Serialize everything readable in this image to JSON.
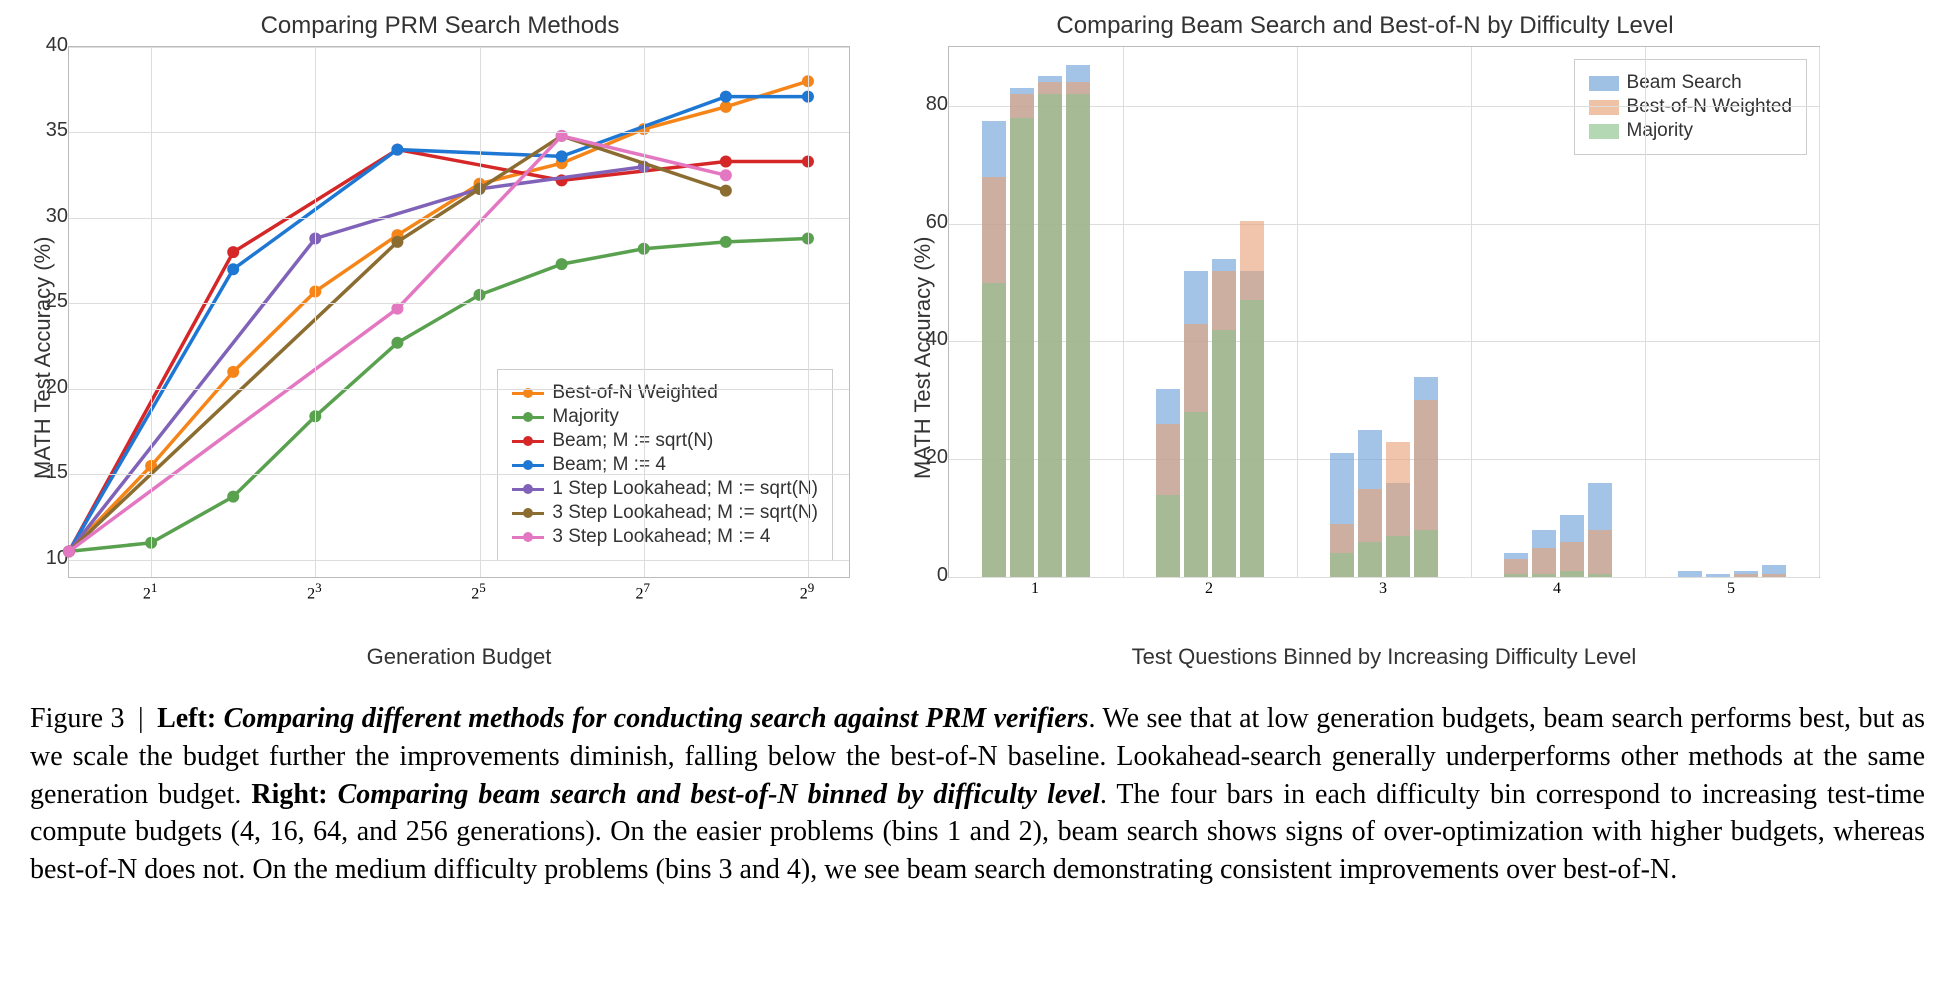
{
  "chart_data": [
    {
      "type": "line",
      "title": "Comparing PRM Search Methods",
      "xlabel": "Generation Budget",
      "ylabel": "MATH Test Accuracy (%)",
      "x_log2": [
        0,
        1,
        2,
        3,
        4,
        5,
        6,
        7,
        8,
        9
      ],
      "x_tick_labels": [
        "2^1",
        "2^3",
        "2^5",
        "2^7",
        "2^9"
      ],
      "x_tick_at_log2": [
        1,
        3,
        5,
        7,
        9
      ],
      "ylim": [
        9,
        40
      ],
      "yticks": [
        10,
        15,
        20,
        25,
        30,
        35,
        40
      ],
      "x_range_log2": [
        0,
        9.5
      ],
      "series": [
        {
          "name": "Best-of-N Weighted",
          "color": "#f58518",
          "x": [
            0,
            1,
            2,
            3,
            4,
            5,
            6,
            7,
            8,
            9
          ],
          "y": [
            10.5,
            15.5,
            21.0,
            25.7,
            29.0,
            32.0,
            33.2,
            35.2,
            36.5,
            38.0
          ]
        },
        {
          "name": "Majority",
          "color": "#59a14f",
          "x": [
            0,
            1,
            2,
            3,
            4,
            5,
            6,
            7,
            8,
            9
          ],
          "y": [
            10.5,
            11.0,
            13.7,
            18.4,
            22.7,
            25.5,
            27.3,
            28.2,
            28.6,
            28.8
          ]
        },
        {
          "name": "Beam; M := sqrt(N)",
          "color": "#d62728",
          "x": [
            0,
            2,
            4,
            6,
            8,
            9
          ],
          "y": [
            10.5,
            28.0,
            34.0,
            32.2,
            33.3,
            33.3
          ]
        },
        {
          "name": "Beam; M := 4",
          "color": "#1f77d4",
          "x": [
            0,
            2,
            4,
            6,
            8,
            9
          ],
          "y": [
            10.5,
            27.0,
            34.0,
            33.6,
            37.1,
            37.1
          ]
        },
        {
          "name": "1 Step Lookahead; M := sqrt(N)",
          "color": "#8063b8",
          "x": [
            0,
            3,
            5,
            7
          ],
          "y": [
            10.5,
            28.8,
            31.7,
            33.0
          ]
        },
        {
          "name": "3 Step Lookahead; M := sqrt(N)",
          "color": "#8c6d31",
          "x": [
            0,
            4,
            5,
            6,
            8
          ],
          "y": [
            10.5,
            28.6,
            31.7,
            34.8,
            31.6
          ]
        },
        {
          "name": "3 Step Lookahead; M := 4",
          "color": "#e377c2",
          "x": [
            0,
            4,
            6,
            8
          ],
          "y": [
            10.5,
            24.7,
            34.8,
            32.5
          ]
        }
      ]
    },
    {
      "type": "bar",
      "title": "Comparing Beam Search and Best-of-N by Difficulty Level",
      "xlabel": "Test Questions Binned by Increasing Difficulty Level",
      "ylabel": "MATH Test Accuracy (%)",
      "ylim": [
        0,
        90
      ],
      "yticks": [
        0,
        20,
        40,
        60,
        80
      ],
      "categories": [
        "1",
        "2",
        "3",
        "4",
        "5"
      ],
      "budgets": [
        4,
        16,
        64,
        256
      ],
      "layers": [
        {
          "name": "Beam Search",
          "color": "#6b9fd6"
        },
        {
          "name": "Best-of-N Weighted",
          "color": "#e6a177"
        },
        {
          "name": "Majority",
          "color": "#8cc28c"
        }
      ],
      "bars_heights": {
        "1": [
          {
            "Majority": 50,
            "Best-of-N Weighted": 68,
            "Beam Search": 77.5
          },
          {
            "Majority": 78,
            "Best-of-N Weighted": 82,
            "Beam Search": 83
          },
          {
            "Majority": 82,
            "Best-of-N Weighted": 84,
            "Beam Search": 85
          },
          {
            "Majority": 82,
            "Best-of-N Weighted": 84,
            "Beam Search": 87
          }
        ],
        "2": [
          {
            "Majority": 14,
            "Best-of-N Weighted": 26,
            "Beam Search": 32
          },
          {
            "Majority": 28,
            "Best-of-N Weighted": 43,
            "Beam Search": 52
          },
          {
            "Majority": 42,
            "Best-of-N Weighted": 52,
            "Beam Search": 54
          },
          {
            "Majority": 47,
            "Best-of-N Weighted": 60.5,
            "Beam Search": 52
          }
        ],
        "3": [
          {
            "Majority": 4,
            "Best-of-N Weighted": 9,
            "Beam Search": 21
          },
          {
            "Majority": 6,
            "Best-of-N Weighted": 15,
            "Beam Search": 25
          },
          {
            "Majority": 7,
            "Best-of-N Weighted": 23,
            "Beam Search": 16
          },
          {
            "Majority": 8,
            "Best-of-N Weighted": 30,
            "Beam Search": 34
          }
        ],
        "4": [
          {
            "Majority": 0.5,
            "Best-of-N Weighted": 3,
            "Beam Search": 4
          },
          {
            "Majority": 0.5,
            "Best-of-N Weighted": 5,
            "Beam Search": 8
          },
          {
            "Majority": 1,
            "Best-of-N Weighted": 6,
            "Beam Search": 10.5
          },
          {
            "Majority": 0.5,
            "Best-of-N Weighted": 8,
            "Beam Search": 16
          }
        ],
        "5": [
          {
            "Majority": 0,
            "Best-of-N Weighted": 0,
            "Beam Search": 1
          },
          {
            "Majority": 0,
            "Best-of-N Weighted": 0,
            "Beam Search": 0.5
          },
          {
            "Majority": 0,
            "Best-of-N Weighted": 0.5,
            "Beam Search": 1
          },
          {
            "Majority": 0,
            "Best-of-N Weighted": 0.5,
            "Beam Search": 2
          }
        ]
      }
    }
  ],
  "caption": {
    "figure_label": "Figure 3",
    "left_heading": "Left:",
    "left_title": "Comparing different methods for conducting search against PRM verifiers",
    "left_body": ". We see that at low generation budgets, beam search performs best, but as we scale the budget further the improvements diminish, falling below the best-of-N baseline. Lookahead-search generally underperforms other methods at the same generation budget. ",
    "right_heading": "Right:",
    "right_title": "Comparing beam search and best-of-N binned by difficulty level",
    "right_body": ". The four bars in each difficulty bin correspond to increasing test-time compute budgets (4, 16, 64, and 256 generations). On the easier problems (bins 1 and 2), beam search shows signs of over-optimization with higher budgets, whereas best-of-N does not. On the medium difficulty problems (bins 3 and 4), we see beam search demonstrating consistent improvements over best-of-N."
  }
}
